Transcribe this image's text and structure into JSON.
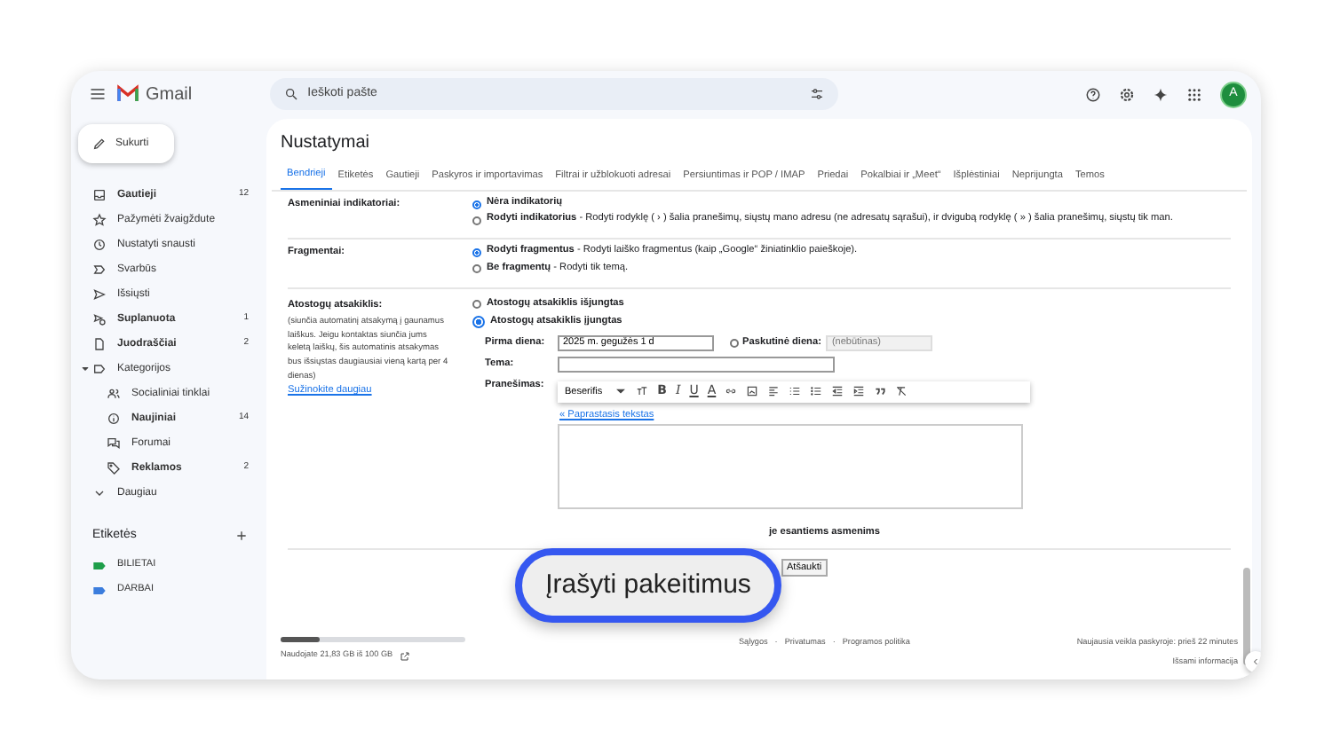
{
  "header": {
    "logo": "Gmail",
    "search_placeholder": "Ieškoti pašte",
    "avatar": "A"
  },
  "compose": "Sukurti",
  "sidebar": {
    "items": [
      {
        "label": "Gautieji",
        "count": "12",
        "unread": true
      },
      {
        "label": "Pažymėti žvaigždute",
        "unread": false
      },
      {
        "label": "Nustatyti snausti",
        "unread": false
      },
      {
        "label": "Svarbūs",
        "unread": false
      },
      {
        "label": "Išsiųsti",
        "unread": false
      },
      {
        "label": "Suplanuota",
        "count": "1",
        "unread": true
      },
      {
        "label": "Juodraščiai",
        "count": "2",
        "unread": true
      },
      {
        "label": "Kategorijos",
        "unread": false,
        "expanded": true,
        "children": [
          {
            "label": "Socialiniai tinklai",
            "unread": false
          },
          {
            "label": "Naujiniai",
            "count": "14",
            "unread": true
          },
          {
            "label": "Forumai",
            "unread": false
          },
          {
            "label": "Reklamos",
            "count": "2",
            "unread": true
          }
        ]
      },
      {
        "label": "Daugiau",
        "unread": false
      }
    ],
    "labels_title": "Etiketės",
    "labels": [
      {
        "name": "BILIETAI",
        "color": "#1e9e4a"
      },
      {
        "name": "DARBAI",
        "color": "#3b7ddd"
      }
    ]
  },
  "settings": {
    "title": "Nustatymai",
    "tabs": [
      {
        "label": "Bendrieji",
        "selected": true
      },
      {
        "label": "Etiketės",
        "selected": false
      },
      {
        "label": "Gautieji",
        "selected": false
      },
      {
        "label": "Paskyros ir importavimas",
        "selected": false
      },
      {
        "label": "Filtrai ir užblokuoti adresai",
        "selected": false
      },
      {
        "label": "Persiuntimas ir POP / IMAP",
        "selected": false
      },
      {
        "label": "Priedai",
        "selected": false
      },
      {
        "label": "Pokalbiai ir „Meet“",
        "selected": false
      },
      {
        "label": "Išplėstiniai",
        "selected": false
      },
      {
        "label": "Neprijungta",
        "selected": false
      },
      {
        "label": "Temos",
        "selected": false
      }
    ],
    "rows": [
      {
        "label": "Asmeniniai indikatoriai:",
        "options": [
          {
            "title": "Nėra indikatorių",
            "selected": true
          },
          {
            "title": "Rodyti indikatorius",
            "description": "- Rodyti rodyklę ( › ) šalia pranešimų, siųstų mano adresu (ne adresatų sąrašui), ir dvigubą rodyklę ( » ) šalia pranešimų, siųstų tik man.",
            "selected": false
          }
        ]
      },
      {
        "label": "Fragmentai:",
        "options": [
          {
            "title": "Rodyti fragmentus",
            "description": "- Rodyti laiško fragmentus (kaip „Google“ žiniatinklio paieškoje).",
            "selected": true
          },
          {
            "title": "Be fragmentų",
            "description": "- Rodyti tik temą.",
            "selected": false
          }
        ]
      }
    ],
    "vacation": {
      "label": "Atostogų atsakiklis:",
      "note": "(siunčia automatinį atsakymą į gaunamus laiškus. Jeigu kontaktas siunčia jums keletą laiškų, šis automatinis atsakymas bus išsiųstas daugiausiai vieną kartą per 4 dienas)",
      "link": "Sužinokite daugiau",
      "options": [
        {
          "title": "Atostogų atsakiklis išjungtas",
          "selected": false
        },
        {
          "title": "Atostogų atsakiklis įjungtas",
          "selected": true
        }
      ],
      "first_day_label": "Pirma diena:",
      "first_day_value": "2025 m. gegužės 1 d",
      "last_day_label": "Paskutinė diena:",
      "last_day_checked": false,
      "last_day_placeholder": "(nebūtinas)",
      "subject_label": "Tema:",
      "message_label": "Pranešimas:",
      "toolbar_font": "Beserifis",
      "toolbar_letters": [
        "B",
        "I",
        "U",
        "A"
      ],
      "plain_text_link": "« Paprastasis tekstas",
      "contacts_option": "je esantiems asmenims"
    },
    "cancel_button": "Atšaukti",
    "callout": "Įrašyti pakeitimus"
  },
  "footer": {
    "storage": {
      "level": 0.21
    },
    "storage_text": "Naudojate 21,83 GB iš 100 GB",
    "links": [
      "Sąlygos",
      "Privatumas",
      "Programos politika"
    ],
    "separator": "·",
    "activity": "Naujausia veikla paskyroje: prieš 22 minutes",
    "details": "Išsami informacija"
  }
}
